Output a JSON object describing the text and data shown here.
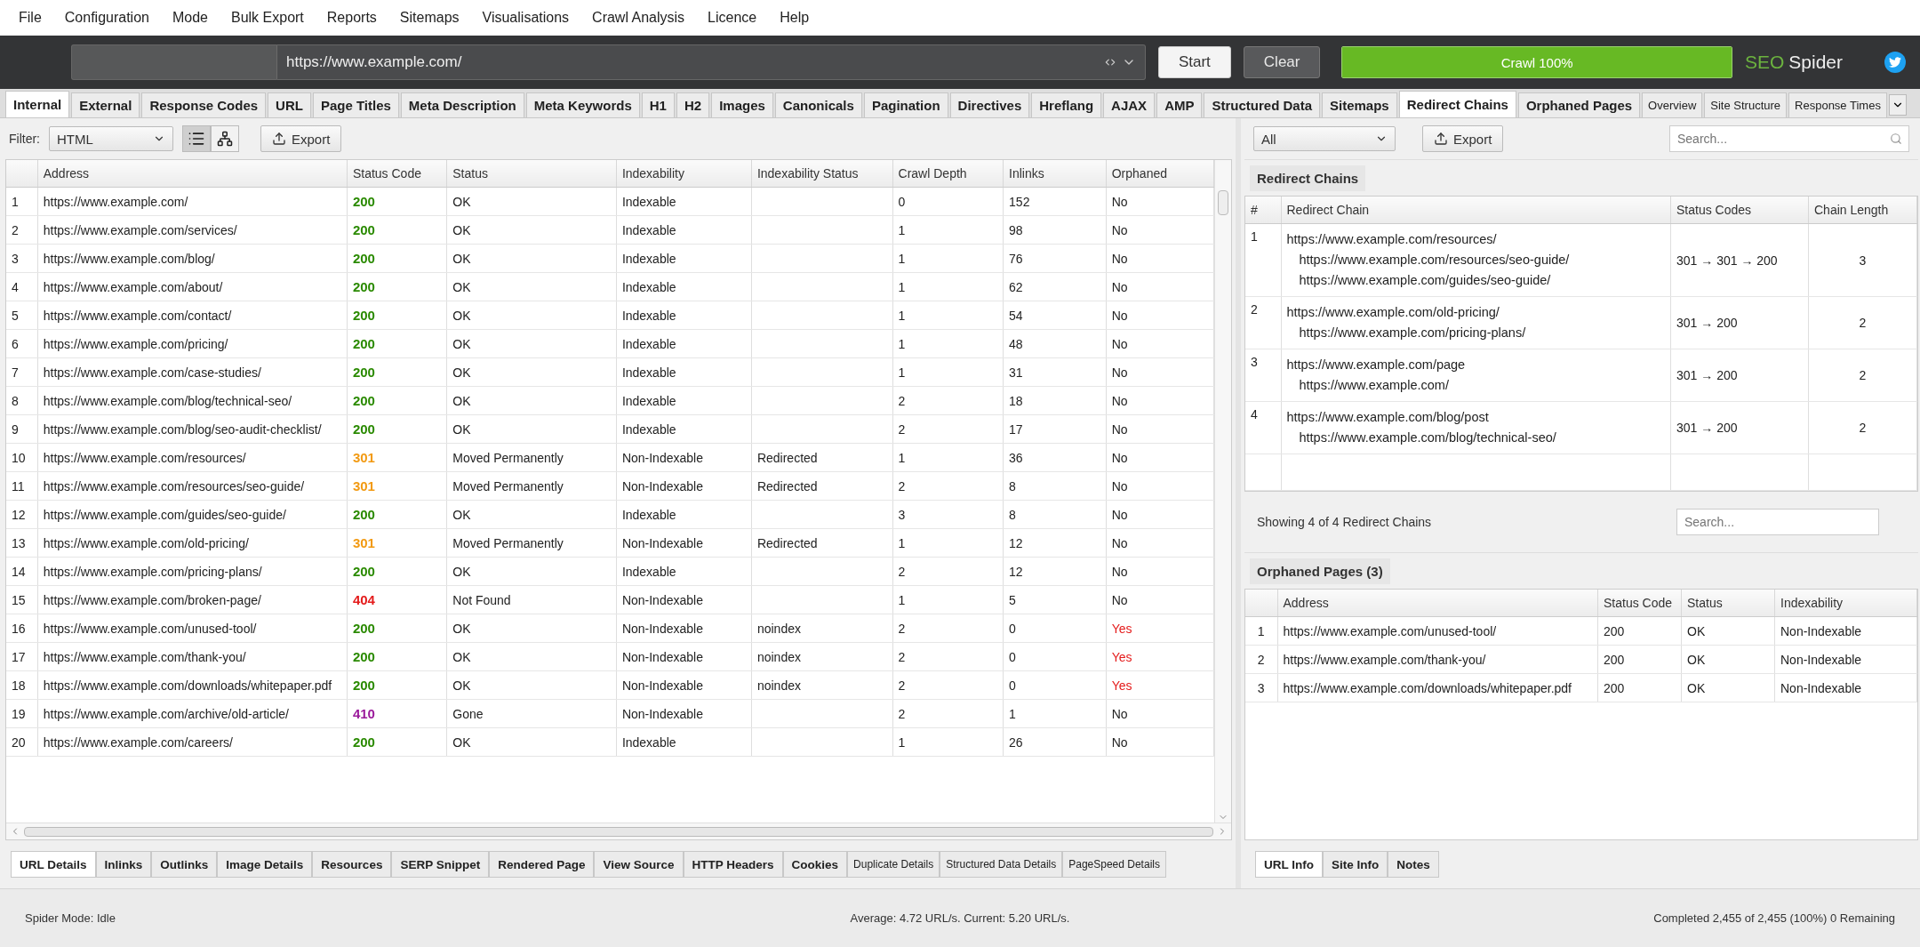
{
  "menu": [
    "File",
    "Configuration",
    "Mode",
    "Bulk Export",
    "Reports",
    "Sitemaps",
    "Visualisations",
    "Crawl Analysis",
    "Licence",
    "Help"
  ],
  "toolbar": {
    "url_field": {
      "value": "https://www.example.com/"
    },
    "buttons": [
      {
        "label": "Start",
        "kind": "light"
      },
      {
        "label": "Clear",
        "kind": "dark"
      }
    ],
    "progress": {
      "label": "Crawl 100%",
      "level": 1
    },
    "logo": {
      "prefix": "SEO",
      "name": "Spider"
    }
  },
  "tabs": [
    {
      "label": "Internal",
      "selected": true,
      "kind": "main"
    },
    {
      "label": "External",
      "selected": false,
      "kind": "main"
    },
    {
      "label": "Response Codes",
      "selected": false,
      "kind": "main"
    },
    {
      "label": "URL",
      "selected": false,
      "kind": "main"
    },
    {
      "label": "Page Titles",
      "selected": false,
      "kind": "main"
    },
    {
      "label": "Meta Description",
      "selected": false,
      "kind": "main"
    },
    {
      "label": "Meta Keywords",
      "selected": false,
      "kind": "main"
    },
    {
      "label": "H1",
      "selected": false,
      "kind": "main"
    },
    {
      "label": "H2",
      "selected": false,
      "kind": "main"
    },
    {
      "label": "Images",
      "selected": false,
      "kind": "main"
    },
    {
      "label": "Canonicals",
      "selected": false,
      "kind": "main"
    },
    {
      "label": "Pagination",
      "selected": false,
      "kind": "main"
    },
    {
      "label": "Directives",
      "selected": false,
      "kind": "main"
    },
    {
      "label": "Hreflang",
      "selected": false,
      "kind": "main"
    },
    {
      "label": "AJAX",
      "selected": false,
      "kind": "main"
    },
    {
      "label": "AMP",
      "selected": false,
      "kind": "main"
    },
    {
      "label": "Structured Data",
      "selected": false,
      "kind": "main"
    },
    {
      "label": "Sitemaps",
      "selected": false,
      "kind": "main"
    },
    {
      "label": "Redirect Chains",
      "selected": true,
      "kind": "main"
    },
    {
      "label": "Orphaned Pages",
      "selected": false,
      "kind": "main"
    },
    {
      "label": "Overview",
      "selected": false,
      "kind": "minor"
    },
    {
      "label": "Site Structure",
      "selected": false,
      "kind": "minor"
    },
    {
      "label": "Response Times",
      "selected": false,
      "kind": "minor"
    }
  ],
  "left_panel": {
    "filter": {
      "label": "Filter:",
      "value": "HTML"
    },
    "view_modes": [
      {
        "kind": "list",
        "selected": true
      },
      {
        "kind": "tree",
        "selected": false
      }
    ],
    "export_button": "Export",
    "table": {
      "columns": [
        "Address",
        "Status Code",
        "Status",
        "Indexability",
        "Indexability Status",
        "Crawl Depth",
        "Inlinks",
        "Orphaned"
      ],
      "rows": [
        {
          "number": "1",
          "address": "https://www.example.com/",
          "status_code": "200",
          "color": "#2a8a00",
          "status": "OK",
          "indexability": "Indexable",
          "crawl_depth": "0",
          "inlinks": "152",
          "orphaned": "No",
          "orphaned_alert": false
        },
        {
          "number": "2",
          "address": "https://www.example.com/services/",
          "status_code": "200",
          "color": "#2a8a00",
          "status": "OK",
          "indexability": "Indexable",
          "crawl_depth": "1",
          "inlinks": "98",
          "orphaned": "No",
          "orphaned_alert": false
        },
        {
          "number": "3",
          "address": "https://www.example.com/blog/",
          "status_code": "200",
          "color": "#2a8a00",
          "status": "OK",
          "indexability": "Indexable",
          "crawl_depth": "1",
          "inlinks": "76",
          "orphaned": "No",
          "orphaned_alert": false
        },
        {
          "number": "4",
          "address": "https://www.example.com/about/",
          "status_code": "200",
          "color": "#2a8a00",
          "status": "OK",
          "indexability": "Indexable",
          "crawl_depth": "1",
          "inlinks": "62",
          "orphaned": "No",
          "orphaned_alert": false
        },
        {
          "number": "5",
          "address": "https://www.example.com/contact/",
          "status_code": "200",
          "color": "#2a8a00",
          "status": "OK",
          "indexability": "Indexable",
          "crawl_depth": "1",
          "inlinks": "54",
          "orphaned": "No",
          "orphaned_alert": false
        },
        {
          "number": "6",
          "address": "https://www.example.com/pricing/",
          "status_code": "200",
          "color": "#2a8a00",
          "status": "OK",
          "indexability": "Indexable",
          "crawl_depth": "1",
          "inlinks": "48",
          "orphaned": "No",
          "orphaned_alert": false
        },
        {
          "number": "7",
          "address": "https://www.example.com/case-studies/",
          "status_code": "200",
          "color": "#2a8a00",
          "status": "OK",
          "indexability": "Indexable",
          "crawl_depth": "1",
          "inlinks": "31",
          "orphaned": "No",
          "orphaned_alert": false
        },
        {
          "number": "8",
          "address": "https://www.example.com/blog/technical-seo/",
          "status_code": "200",
          "color": "#2a8a00",
          "status": "OK",
          "indexability": "Indexable",
          "crawl_depth": "2",
          "inlinks": "18",
          "orphaned": "No",
          "orphaned_alert": false
        },
        {
          "number": "9",
          "address": "https://www.example.com/blog/seo-audit-checklist/",
          "status_code": "200",
          "color": "#2a8a00",
          "status": "OK",
          "indexability": "Indexable",
          "crawl_depth": "2",
          "inlinks": "17",
          "orphaned": "No",
          "orphaned_alert": false
        },
        {
          "number": "10",
          "address": "https://www.example.com/resources/",
          "status_code": "301",
          "color": "#f29a12",
          "status": "Moved Permanently",
          "indexability": "Non-Indexable",
          "indexability_status": "Redirected",
          "crawl_depth": "1",
          "inlinks": "36",
          "orphaned": "No",
          "orphaned_alert": false
        },
        {
          "number": "11",
          "address": "https://www.example.com/resources/seo-guide/",
          "status_code": "301",
          "color": "#f29a12",
          "status": "Moved Permanently",
          "indexability": "Non-Indexable",
          "indexability_status": "Redirected",
          "crawl_depth": "2",
          "inlinks": "8",
          "orphaned": "No",
          "orphaned_alert": false
        },
        {
          "number": "12",
          "address": "https://www.example.com/guides/seo-guide/",
          "status_code": "200",
          "color": "#2a8a00",
          "status": "OK",
          "indexability": "Indexable",
          "crawl_depth": "3",
          "inlinks": "8",
          "orphaned": "No",
          "orphaned_alert": false
        },
        {
          "number": "13",
          "address": "https://www.example.com/old-pricing/",
          "status_code": "301",
          "color": "#f29a12",
          "status": "Moved Permanently",
          "indexability": "Non-Indexable",
          "indexability_status": "Redirected",
          "crawl_depth": "1",
          "inlinks": "12",
          "orphaned": "No",
          "orphaned_alert": false
        },
        {
          "number": "14",
          "address": "https://www.example.com/pricing-plans/",
          "status_code": "200",
          "color": "#2a8a00",
          "status": "OK",
          "indexability": "Indexable",
          "crawl_depth": "2",
          "inlinks": "12",
          "orphaned": "No",
          "orphaned_alert": false
        },
        {
          "number": "15",
          "address": "https://www.example.com/broken-page/",
          "status_code": "404",
          "color": "#e41b1b",
          "status": "Not Found",
          "indexability": "Non-Indexable",
          "crawl_depth": "1",
          "inlinks": "5",
          "orphaned": "No",
          "orphaned_alert": false
        },
        {
          "number": "16",
          "address": "https://www.example.com/unused-tool/",
          "status_code": "200",
          "color": "#2a8a00",
          "status": "OK",
          "indexability": "Non-Indexable",
          "indexability_status": "noindex",
          "crawl_depth": "2",
          "inlinks": "0",
          "orphaned": "Yes",
          "orphaned_alert": true
        },
        {
          "number": "17",
          "address": "https://www.example.com/thank-you/",
          "status_code": "200",
          "color": "#2a8a00",
          "status": "OK",
          "indexability": "Non-Indexable",
          "indexability_status": "noindex",
          "crawl_depth": "2",
          "inlinks": "0",
          "orphaned": "Yes",
          "orphaned_alert": true
        },
        {
          "number": "18",
          "address": "https://www.example.com/downloads/whitepaper.pdf",
          "status_code": "200",
          "color": "#2a8a00",
          "status": "OK",
          "indexability": "Non-Indexable",
          "indexability_status": "noindex",
          "crawl_depth": "2",
          "inlinks": "0",
          "orphaned": "Yes",
          "orphaned_alert": true
        },
        {
          "number": "19",
          "address": "https://www.example.com/archive/old-article/",
          "status_code": "410",
          "color": "#9b1a9b",
          "status": "Gone",
          "indexability": "Non-Indexable",
          "crawl_depth": "2",
          "inlinks": "1",
          "orphaned": "No",
          "orphaned_alert": false
        },
        {
          "number": "20",
          "address": "https://www.example.com/careers/",
          "status_code": "200",
          "color": "#2a8a00",
          "status": "OK",
          "indexability": "Indexable",
          "crawl_depth": "1",
          "inlinks": "26",
          "orphaned": "No",
          "orphaned_alert": false
        }
      ]
    },
    "bottom_tabs": [
      {
        "label": "URL Details",
        "selected": true,
        "kind": "main"
      },
      {
        "label": "Inlinks",
        "selected": false,
        "kind": "main"
      },
      {
        "label": "Outlinks",
        "selected": false,
        "kind": "main"
      },
      {
        "label": "Image Details",
        "selected": false,
        "kind": "main"
      },
      {
        "label": "Resources",
        "selected": false,
        "kind": "main"
      },
      {
        "label": "SERP Snippet",
        "selected": false,
        "kind": "main"
      },
      {
        "label": "Rendered Page",
        "selected": false,
        "kind": "main"
      },
      {
        "label": "View Source",
        "selected": false,
        "kind": "main"
      },
      {
        "label": "HTTP Headers",
        "selected": false,
        "kind": "main"
      },
      {
        "label": "Cookies",
        "selected": false,
        "kind": "main"
      },
      {
        "label": "Duplicate Details",
        "selected": false,
        "kind": "minor"
      },
      {
        "label": "Structured Data Details",
        "selected": false,
        "kind": "minor"
      },
      {
        "label": "PageSpeed Details",
        "selected": false,
        "kind": "minor"
      }
    ]
  },
  "right_panel": {
    "filter": {
      "value": "All"
    },
    "export_button": "Export",
    "search": {
      "placeholder": "Search..."
    },
    "redirect_chains": {
      "title": "Redirect Chains",
      "columns": [
        "#",
        "Redirect Chain",
        "Status Codes",
        "Chain Length"
      ],
      "rows": [
        {
          "number": "1",
          "chain": [
            "https://www.example.com/resources/",
            "https://www.example.com/resources/seo-guide/",
            "https://www.example.com/guides/seo-guide/"
          ],
          "status_codes": "301 → 301 → 200",
          "chain_length": "3"
        },
        {
          "number": "2",
          "chain": [
            "https://www.example.com/old-pricing/",
            "https://www.example.com/pricing-plans/"
          ],
          "status_codes": "301 → 200",
          "chain_length": "2"
        },
        {
          "number": "3",
          "chain": [
            "https://www.example.com/page",
            "https://www.example.com/"
          ],
          "status_codes": "301 → 200",
          "chain_length": "2"
        },
        {
          "number": "4",
          "chain": [
            "https://www.example.com/blog/post",
            "https://www.example.com/blog/technical-seo/"
          ],
          "status_codes": "301 → 200",
          "chain_length": "2"
        }
      ],
      "footer": "Showing 4 of 4 Redirect Chains",
      "search": {
        "placeholder": "Search..."
      }
    },
    "orphaned_pages": {
      "title": "Orphaned Pages (3)",
      "columns": [
        "Address",
        "Status Code",
        "Status",
        "Indexability"
      ],
      "rows": [
        {
          "number": "1",
          "address": "https://www.example.com/unused-tool/",
          "status_code": "200",
          "status": "OK",
          "indexability": "Non-Indexable"
        },
        {
          "number": "2",
          "address": "https://www.example.com/thank-you/",
          "status_code": "200",
          "status": "OK",
          "indexability": "Non-Indexable"
        },
        {
          "number": "3",
          "address": "https://www.example.com/downloads/whitepaper.pdf",
          "status_code": "200",
          "status": "OK",
          "indexability": "Non-Indexable"
        }
      ]
    },
    "bottom_tabs": [
      {
        "label": "URL Info",
        "selected": true,
        "kind": "main"
      },
      {
        "label": "Site Info",
        "selected": false,
        "kind": "main"
      },
      {
        "label": "Notes",
        "selected": false,
        "kind": "main"
      }
    ]
  },
  "status_bar": {
    "mode": "Spider Mode: Idle",
    "speed": "Average: 4.72 URL/s. Current: 5.20 URL/s.",
    "progress": "Completed 2,455 of 2,455 (100%) 0 Remaining"
  }
}
